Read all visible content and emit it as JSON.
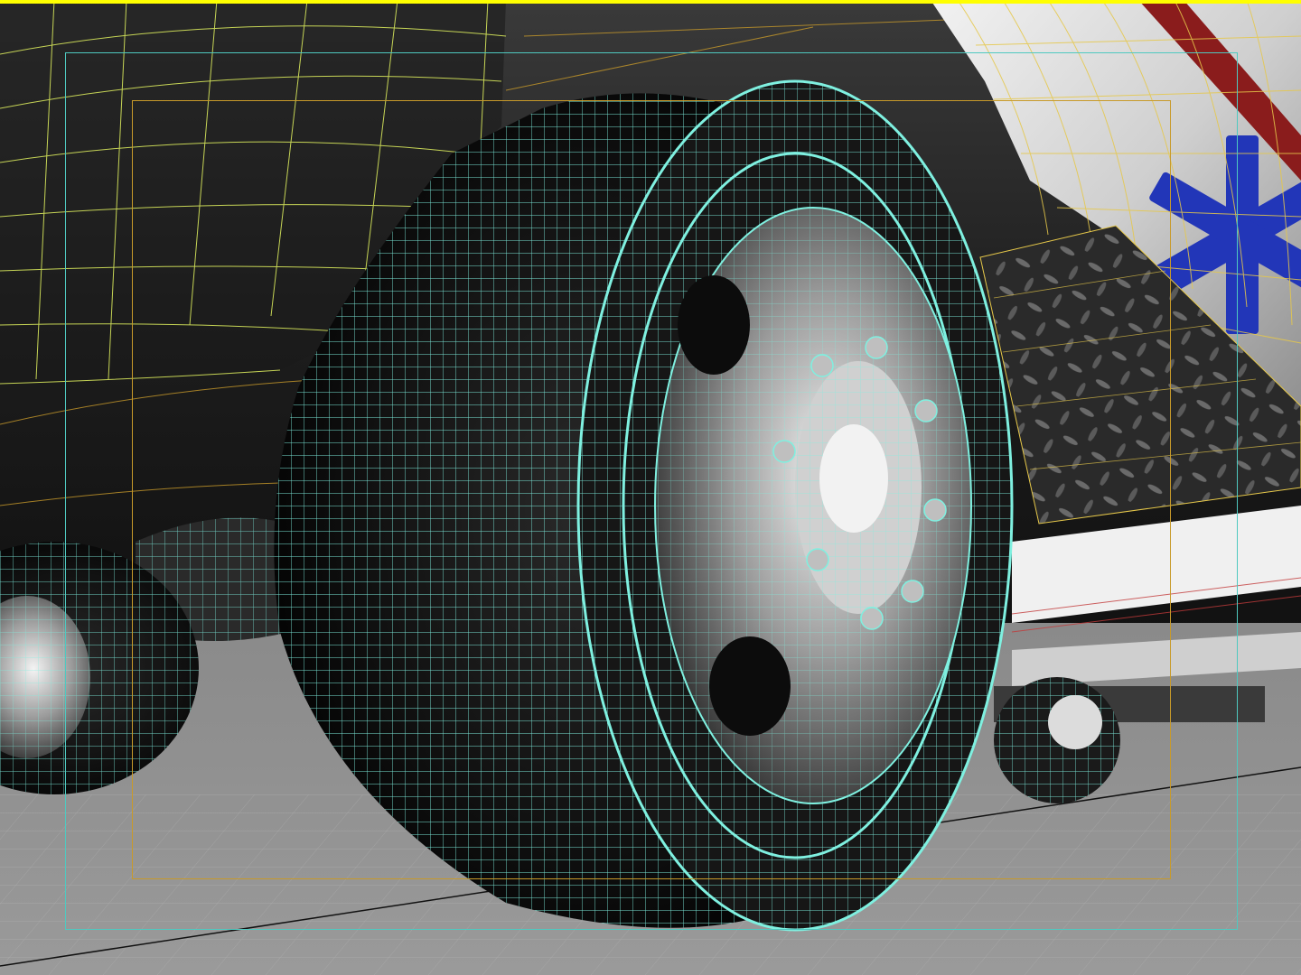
{
  "viewport": {
    "active_border_color": "#ffff00",
    "background_color": "#8c8c8c",
    "selection_wire_color": "#7ff0e0",
    "body_wire_color": "#d8e85c",
    "chassis_wire_color": "#c89a2a",
    "safe_frame_outer_color": "#4fc9c0",
    "safe_frame_inner_color": "#c89a2a",
    "star_of_life_color": "#2236b8",
    "stripe_color": "#8a1c1c",
    "floor_grid_color": "#b4b4b4"
  }
}
